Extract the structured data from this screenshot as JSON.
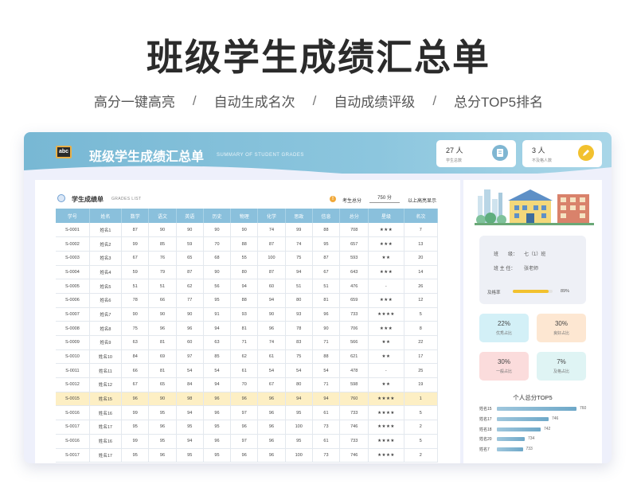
{
  "hero": {
    "title": "班级学生成绩汇总单",
    "features": [
      "高分一键高亮",
      "自动生成名次",
      "自动成绩评级",
      "总分TOP5排名"
    ],
    "separator": "/"
  },
  "header": {
    "logo_text": "abc",
    "title": "班级学生成绩汇总单",
    "subtitle": "SUMMARY OF STUDENT GRADES",
    "cards": [
      {
        "value": "27 人",
        "label": "学生总数",
        "icon": "document-icon"
      },
      {
        "value": "3 人",
        "label": "不及格人数",
        "icon": "pen-icon"
      }
    ]
  },
  "grades": {
    "title": "学生成绩单",
    "subtitle": "GRADES LIST",
    "score_label": "考生总分",
    "score_value": "750",
    "score_suffix": "分",
    "score_hint": "以上高亮显示",
    "columns": [
      "学号",
      "姓名",
      "数学",
      "语文",
      "英语",
      "历史",
      "物理",
      "化学",
      "思政",
      "信息",
      "总分",
      "星级",
      "名次"
    ],
    "rows": [
      [
        "S-0001",
        "姓名1",
        "87",
        "90",
        "90",
        "90",
        "90",
        "74",
        "99",
        "88",
        "708",
        "★★★",
        "7"
      ],
      [
        "S-0002",
        "姓名2",
        "99",
        "85",
        "59",
        "70",
        "88",
        "87",
        "74",
        "95",
        "657",
        "★★★",
        "13"
      ],
      [
        "S-0003",
        "姓名3",
        "67",
        "76",
        "65",
        "68",
        "55",
        "100",
        "75",
        "87",
        "593",
        "★★",
        "20"
      ],
      [
        "S-0004",
        "姓名4",
        "59",
        "79",
        "87",
        "90",
        "80",
        "87",
        "94",
        "67",
        "643",
        "★★★",
        "14"
      ],
      [
        "S-0005",
        "姓名5",
        "51",
        "51",
        "62",
        "56",
        "94",
        "60",
        "51",
        "51",
        "476",
        "-",
        "26"
      ],
      [
        "S-0006",
        "姓名6",
        "78",
        "66",
        "77",
        "95",
        "88",
        "94",
        "80",
        "81",
        "659",
        "★★★",
        "12"
      ],
      [
        "S-0007",
        "姓名7",
        "90",
        "90",
        "90",
        "91",
        "93",
        "90",
        "93",
        "96",
        "733",
        "★★★★",
        "5"
      ],
      [
        "S-0008",
        "姓名8",
        "75",
        "96",
        "96",
        "94",
        "81",
        "96",
        "78",
        "90",
        "706",
        "★★★",
        "8"
      ],
      [
        "S-0009",
        "姓名9",
        "63",
        "81",
        "60",
        "63",
        "71",
        "74",
        "83",
        "71",
        "566",
        "★★",
        "22"
      ],
      [
        "S-0010",
        "姓名10",
        "84",
        "69",
        "97",
        "85",
        "62",
        "61",
        "75",
        "88",
        "621",
        "★★",
        "17"
      ],
      [
        "S-0011",
        "姓名11",
        "66",
        "81",
        "54",
        "54",
        "61",
        "54",
        "54",
        "54",
        "478",
        "-",
        "25"
      ],
      [
        "S-0012",
        "姓名12",
        "67",
        "65",
        "84",
        "94",
        "70",
        "67",
        "80",
        "71",
        "598",
        "★★",
        "19"
      ],
      [
        "S-0015",
        "姓名15",
        "96",
        "90",
        "98",
        "96",
        "96",
        "96",
        "94",
        "94",
        "760",
        "★★★★",
        "1"
      ],
      [
        "S-0016",
        "姓名16",
        "99",
        "95",
        "94",
        "96",
        "97",
        "96",
        "95",
        "61",
        "733",
        "★★★★",
        "5"
      ],
      [
        "S-0017",
        "姓名17",
        "95",
        "96",
        "95",
        "95",
        "96",
        "96",
        "100",
        "73",
        "746",
        "★★★★",
        "2"
      ],
      [
        "S-0016",
        "姓名16",
        "99",
        "95",
        "94",
        "96",
        "97",
        "96",
        "95",
        "61",
        "733",
        "★★★★",
        "5"
      ],
      [
        "S-0017",
        "姓名17",
        "95",
        "96",
        "95",
        "95",
        "96",
        "96",
        "100",
        "73",
        "746",
        "★★★★",
        "2"
      ]
    ],
    "highlight_row": 12,
    "colors": {
      "header": "#8ac0dc",
      "highlight": "#fdefc4",
      "stars": "#f2b12f"
    }
  },
  "class_info": {
    "class_label": "班　　级：",
    "class_value": "七（1）班",
    "teacher_label": "班 主 任：",
    "teacher_value": "张老师",
    "pass_label": "及格率",
    "pass_rate": 0.89,
    "pass_text": "89%"
  },
  "ratios": [
    {
      "value": "22%",
      "label": "优秀占比",
      "color": "#d3f0f7"
    },
    {
      "value": "30%",
      "label": "良好占比",
      "color": "#fde7d2"
    },
    {
      "value": "30%",
      "label": "一般占比",
      "color": "#fbdcdc"
    },
    {
      "value": "7%",
      "label": "及格占比",
      "color": "#dff4f4"
    }
  ],
  "top5": {
    "title": "个人总分TOP5",
    "items": [
      {
        "name": "姓名15",
        "score": 760
      },
      {
        "name": "姓名17",
        "score": 746
      },
      {
        "name": "姓名18",
        "score": 742
      },
      {
        "name": "姓名20",
        "score": 734
      },
      {
        "name": "姓名7",
        "score": 733
      }
    ]
  }
}
